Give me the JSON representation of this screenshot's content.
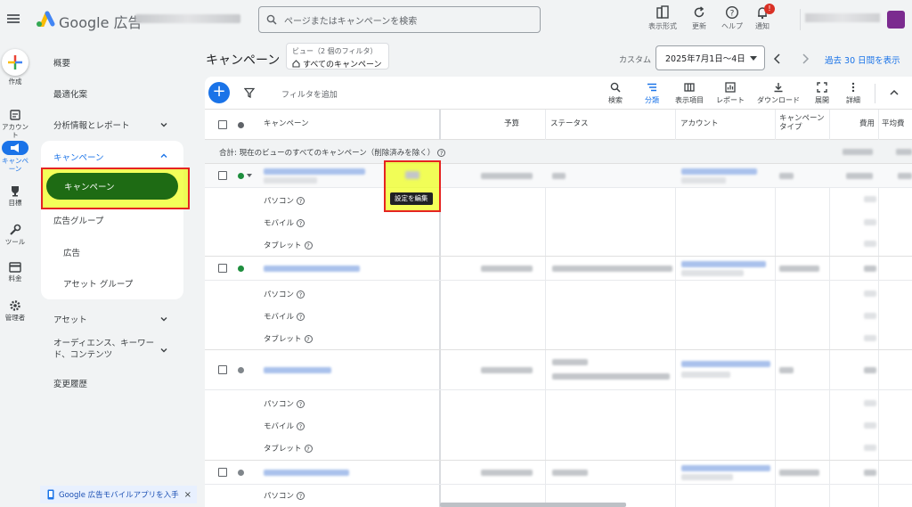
{
  "app": {
    "brand": "Google 広告",
    "search_placeholder": "ページまたはキャンペーンを検索",
    "top_actions": [
      {
        "label": "表示形式",
        "icon": "appearance-icon"
      },
      {
        "label": "更新",
        "icon": "refresh-icon"
      },
      {
        "label": "ヘルプ",
        "icon": "help-icon"
      },
      {
        "label": "通知",
        "icon": "bell-icon",
        "badge": "!"
      }
    ]
  },
  "rail": {
    "create": "作成",
    "account": "アカウント",
    "campaign": "キャンペーン",
    "goals": "目標",
    "tools": "ツール",
    "billing": "料金",
    "admin": "管理者"
  },
  "nav": {
    "overview": "概要",
    "optimization": "最適化案",
    "insights": "分析情報とレポート",
    "campaigns_group": "キャンペーン",
    "campaigns": "キャンペーン",
    "ad_groups": "広告グループ",
    "ads": "広告",
    "asset_groups": "アセット グループ",
    "assets": "アセット",
    "audiences": "オーディエンス、キーワード、コンテンツ",
    "change_history": "変更履歴",
    "promo": "Google 広告モバイルアプリを入手",
    "promo_close": "×"
  },
  "main": {
    "title": "キャンペーン",
    "view_filter_line1": "ビュー（2 個のフィルタ）",
    "view_filter_line2": "すべてのキャンペーン",
    "date_custom": "カスタム",
    "date_range": "2025年7月1日〜4日",
    "show_last": "過去 30 日間を表示",
    "add_filter": "フィルタを追加",
    "tools": [
      {
        "label": "検索",
        "icon": "search-icon"
      },
      {
        "label": "分類",
        "icon": "segment-icon",
        "active": true
      },
      {
        "label": "表示項目",
        "icon": "columns-icon"
      },
      {
        "label": "レポート",
        "icon": "report-icon"
      },
      {
        "label": "ダウンロード",
        "icon": "download-icon"
      },
      {
        "label": "展開",
        "icon": "expand-icon"
      },
      {
        "label": "詳細",
        "icon": "more-icon"
      }
    ],
    "columns": {
      "campaign": "キャンペーン",
      "budget": "予算",
      "status": "ステータス",
      "account": "アカウント",
      "campaign_type": "キャンペーン タイプ",
      "cost": "費用",
      "avg": "平均費"
    },
    "total_label": "合計: 現在のビューのすべてのキャンペーン（削除済みを除く）",
    "device_rows": [
      "パソコン",
      "モバイル",
      "タブレット"
    ],
    "tooltip": "設定を編集"
  },
  "colors": {
    "active_nav": "#1e6b14",
    "highlight_fill": "#ecff00",
    "highlight_border": "#e52421",
    "accent": "#1a73e8",
    "status_enabled": "#1e8e3e",
    "status_paused": "#80868b"
  }
}
